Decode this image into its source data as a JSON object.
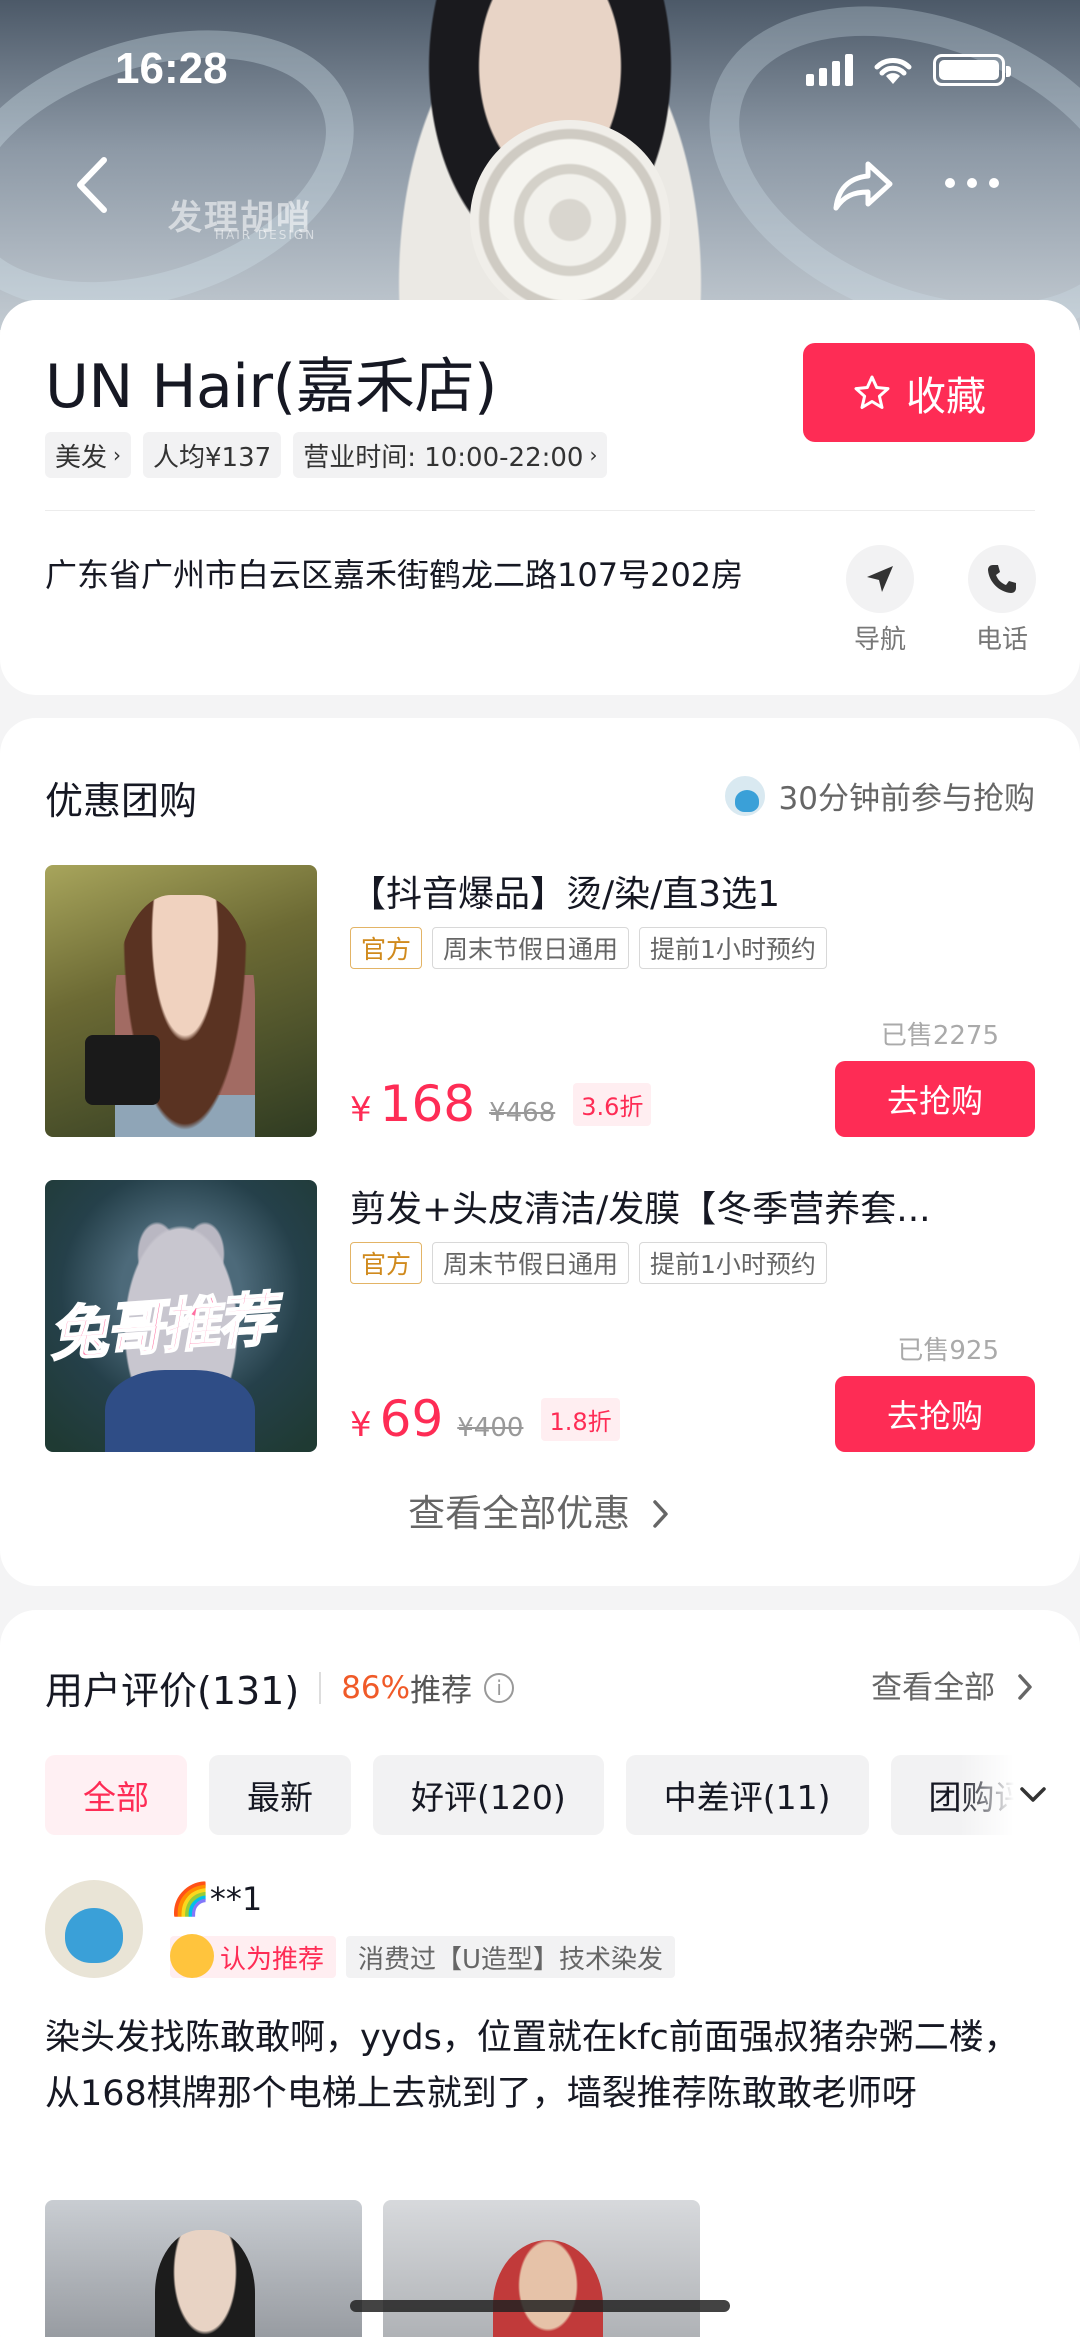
{
  "status_bar": {
    "time": "16:28"
  },
  "hero": {
    "watermark": "发理胡哨",
    "watermark_sub": "HAIR DESIGN"
  },
  "shop": {
    "name": "UN Hair(嘉禾店)",
    "favorite_label": "收藏",
    "tags": [
      "美发",
      "人均¥137",
      "营业时间: 10:00-22:00"
    ],
    "address": "广东省广州市白云区嘉禾街鹤龙二路107号202房",
    "actions": [
      {
        "label": "导航",
        "icon": "navigation-icon"
      },
      {
        "label": "电话",
        "icon": "phone-icon"
      }
    ]
  },
  "deals": {
    "title": "优惠团购",
    "recent_activity": "30分钟前参与抢购",
    "items": [
      {
        "title": "【抖音爆品】烫/染/直3选1",
        "tags": [
          "官方",
          "周末节假日通用",
          "提前1小时预约"
        ],
        "sold": "已售2275",
        "price": "168",
        "original": "¥468",
        "discount": "3.6折",
        "buy_label": "去抢购"
      },
      {
        "title": "剪发+头皮清洁/发膜【冬季营养套...",
        "tags": [
          "官方",
          "周末节假日通用",
          "提前1小时预约"
        ],
        "sold": "已售925",
        "price": "69",
        "original": "¥400",
        "discount": "1.8折",
        "buy_label": "去抢购",
        "image_caption": "兔哥推荐"
      }
    ],
    "currency": "¥",
    "see_all": "查看全部优惠"
  },
  "reviews": {
    "title": "用户评价(131)",
    "recommend_pct": "86%",
    "recommend_label": "推荐",
    "view_all": "查看全部",
    "filters": [
      "全部",
      "最新",
      "好评(120)",
      "中差评(11)",
      "团购评"
    ],
    "active_filter": "全部",
    "review": {
      "name": "🌈**1",
      "badge": "认为推荐",
      "consumed": "消费过【U造型】技术染发",
      "text": "染头发找陈敢敢啊，yyds，位置就在kfc前面强叔猪杂粥二楼，从168棋牌那个电梯上去就到了，墙裂推荐陈敢敢老师呀"
    }
  },
  "colors": {
    "accent": "#fe2c55",
    "official": "#d08a1d",
    "recommend": "#f05a28"
  }
}
